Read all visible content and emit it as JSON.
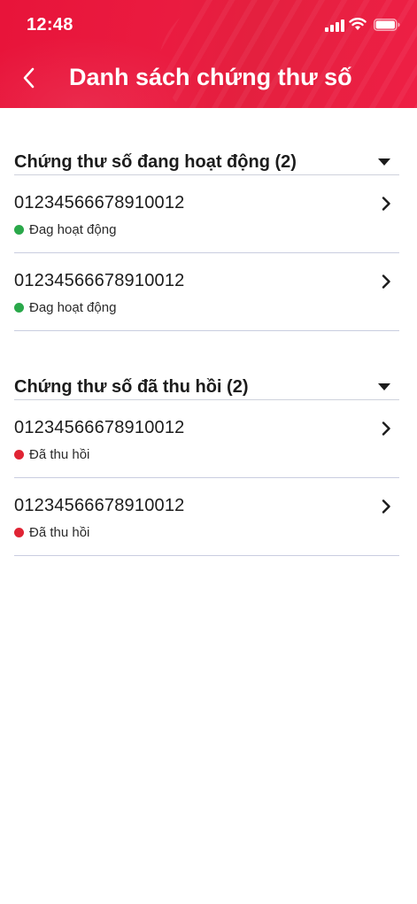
{
  "status_bar": {
    "time": "12:48"
  },
  "nav": {
    "title": "Danh sách chứng thư số"
  },
  "colors": {
    "header_red": "#e8163c",
    "active_green": "#2aa84a",
    "revoked_red": "#e02434"
  },
  "sections": [
    {
      "title": "Chứng thư số đang hoạt động (2)",
      "items": [
        {
          "number": "01234566678910012",
          "status": "Đag hoạt động",
          "status_color": "#2aa84a"
        },
        {
          "number": "01234566678910012",
          "status": "Đag hoạt động",
          "status_color": "#2aa84a"
        }
      ]
    },
    {
      "title": "Chứng thư số đã thu hồi (2)",
      "items": [
        {
          "number": "01234566678910012",
          "status": "Đã thu hồi",
          "status_color": "#e02434"
        },
        {
          "number": "01234566678910012",
          "status": "Đã thu hồi",
          "status_color": "#e02434"
        }
      ]
    }
  ]
}
